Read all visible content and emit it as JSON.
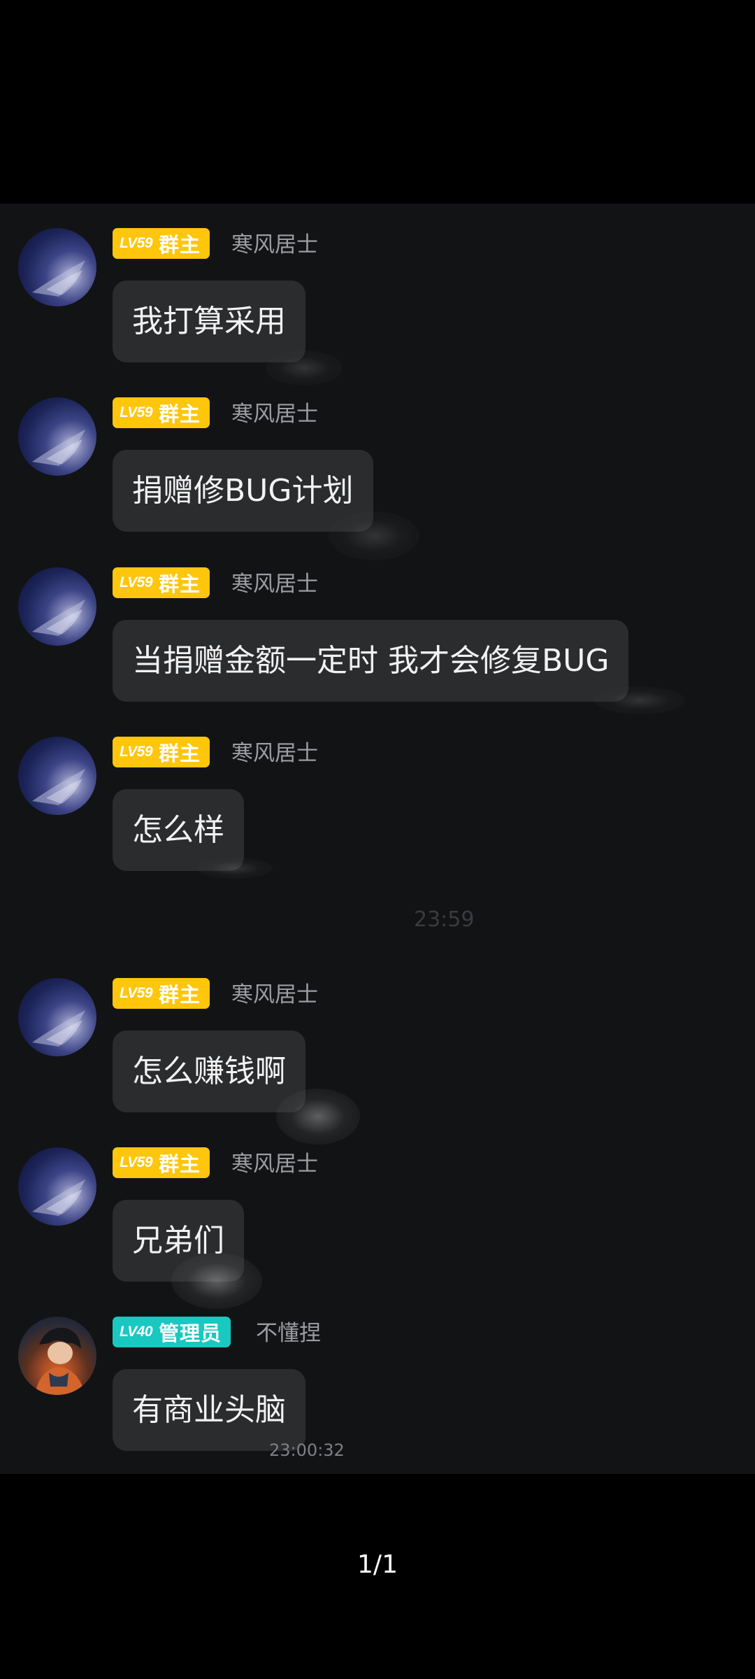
{
  "messages": [
    {
      "level": "LV59",
      "role": "群主",
      "sender": "寒风居士",
      "text": "我打算采用"
    },
    {
      "level": "LV59",
      "role": "群主",
      "sender": "寒风居士",
      "text": "捐赠修BUG计划"
    },
    {
      "level": "LV59",
      "role": "群主",
      "sender": "寒风居士",
      "text": "当捐赠金额一定时 我才会修复BUG"
    },
    {
      "level": "LV59",
      "role": "群主",
      "sender": "寒风居士",
      "text": "怎么样"
    },
    {
      "level": "LV59",
      "role": "群主",
      "sender": "寒风居士",
      "text": "怎么赚钱啊"
    },
    {
      "level": "LV59",
      "role": "群主",
      "sender": "寒风居士",
      "text": "兄弟们"
    },
    {
      "level": "LV40",
      "role": "管理员",
      "sender": "不懂捏",
      "text": "有商业头脑",
      "timestamp": "23:00:32"
    }
  ],
  "faded_time_marker": "23:59",
  "page_counter": "1/1",
  "colors": {
    "owner_badge": "#ffc60b",
    "admin_badge": "#19c8c1",
    "bubble": "#2b2c2e",
    "panel": "#121315"
  },
  "icons": {
    "owner_avatar": "night-sky-avatar-icon",
    "admin_avatar": "anime-character-avatar-icon"
  }
}
